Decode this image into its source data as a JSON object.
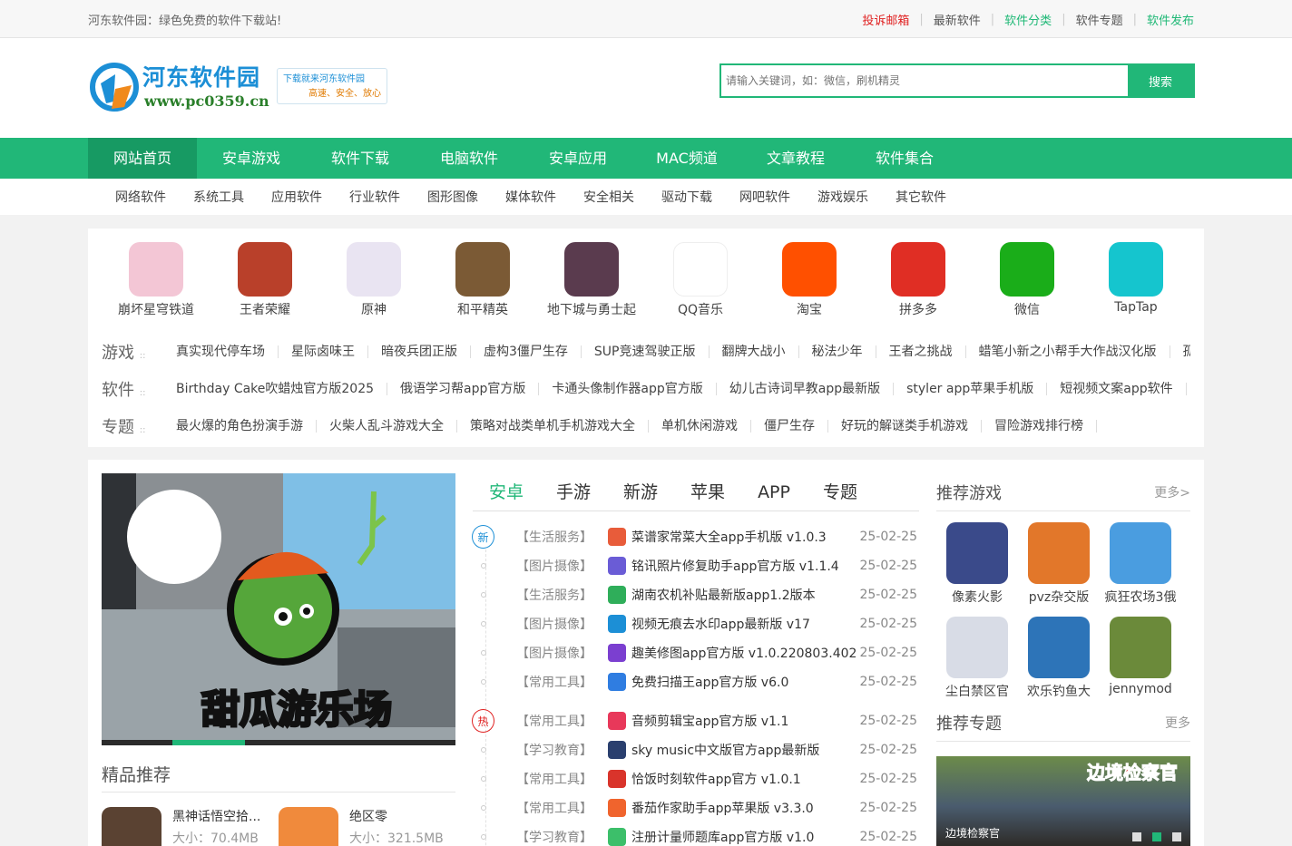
{
  "topbar": {
    "slogan": "河东软件园：绿色免费的软件下载站!",
    "links": [
      "投诉邮箱",
      "最新软件",
      "软件分类",
      "软件专题",
      "软件发布"
    ]
  },
  "header": {
    "logo_title": "河东软件园",
    "logo_url": "www.pc0359.cn",
    "slogan_line1": "下载就来河东软件园",
    "slogan_line2": "高速、安全、放心",
    "search_placeholder": "请输入关键词，如：微信，刷机精灵",
    "search_button": "搜索"
  },
  "nav": [
    "网站首页",
    "安卓游戏",
    "软件下载",
    "电脑软件",
    "安卓应用",
    "MAC频道",
    "文章教程",
    "软件集合"
  ],
  "subnav": [
    "网络软件",
    "系统工具",
    "应用软件",
    "行业软件",
    "图形图像",
    "媒体软件",
    "安全相关",
    "驱动下载",
    "网吧软件",
    "游戏娱乐",
    "其它软件"
  ],
  "hot_apps": [
    {
      "name": "崩坏星穹铁道",
      "color": "#f3c6d5"
    },
    {
      "name": "王者荣耀",
      "color": "#b9402a"
    },
    {
      "name": "原神",
      "color": "#e9e4f2"
    },
    {
      "name": "和平精英",
      "color": "#7b5a35"
    },
    {
      "name": "地下城与勇士起",
      "color": "#5a3b4e"
    },
    {
      "name": "QQ音乐",
      "color": "#ffffff"
    },
    {
      "name": "淘宝",
      "color": "#ff5000"
    },
    {
      "name": "拼多多",
      "color": "#e02e24"
    },
    {
      "name": "微信",
      "color": "#1aad19"
    },
    {
      "name": "TapTap",
      "color": "#15c5ce"
    }
  ],
  "tag_rows": [
    {
      "label": "游戏",
      "items": [
        "真实现代停车场",
        "星际卤味王",
        "暗夜兵团正版",
        "虚构3僵尸生存",
        "SUP竞速驾驶正版",
        "翻牌大战小",
        "秘法少年",
        "王者之挑战",
        "蜡笔小新之小帮手大作战汉化版",
        "孤"
      ]
    },
    {
      "label": "软件",
      "items": [
        "Birthday Cake吹蜡烛官方版2025",
        "俄语学习帮app官方版",
        "卡通头像制作器app官方版",
        "幼儿古诗词早教app最新版",
        "styler app苹果手机版",
        "短视频文案app软件"
      ]
    },
    {
      "label": "专题",
      "items": [
        "最火爆的角色扮演手游",
        "火柴人乱斗游戏大全",
        "策略对战类单机手机游戏大全",
        "单机休闲游戏",
        "僵尸生存",
        "好玩的解谜类手机游戏",
        "冒险游戏排行榜"
      ]
    }
  ],
  "banner": {
    "caption": "甜瓜游乐场"
  },
  "best": {
    "title": "精品推荐",
    "items": [
      {
        "name": "黑神话悟空拾...",
        "size": "大小：70.4MB"
      },
      {
        "name": "绝区零",
        "size": "大小：321.5MB"
      }
    ]
  },
  "tabs": [
    "安卓",
    "手游",
    "新游",
    "苹果",
    "APP",
    "专题"
  ],
  "badges": {
    "new": "新",
    "hot": "热"
  },
  "list_new": [
    {
      "cat": "【生活服务】",
      "title": "菜谱家常菜大全app手机版 v1.0.3",
      "date": "25-02-25",
      "color": "#e85c3a"
    },
    {
      "cat": "【图片摄像】",
      "title": "铭讯照片修复助手app官方版 v1.1.4",
      "date": "25-02-25",
      "color": "#6a5cd6"
    },
    {
      "cat": "【生活服务】",
      "title": "湖南农机补贴最新版app1.2版本",
      "date": "25-02-25",
      "color": "#2fae5a"
    },
    {
      "cat": "【图片摄像】",
      "title": "视频无痕去水印app最新版 v17",
      "date": "25-02-25",
      "color": "#1c8fd6"
    },
    {
      "cat": "【图片摄像】",
      "title": "趣美修图app官方版 v1.0.220803.402",
      "date": "25-02-25",
      "color": "#7b3fd0"
    },
    {
      "cat": "【常用工具】",
      "title": "免费扫描王app官方版 v6.0",
      "date": "25-02-25",
      "color": "#2f7de1"
    }
  ],
  "list_hot": [
    {
      "cat": "【常用工具】",
      "title": "音频剪辑宝app官方版 v1.1",
      "date": "25-02-25",
      "color": "#e8385a"
    },
    {
      "cat": "【学习教育】",
      "title": "sky music中文版官方app最新版",
      "date": "25-02-25",
      "color": "#2a3f6e"
    },
    {
      "cat": "【常用工具】",
      "title": "恰饭时刻软件app官方 v1.0.1",
      "date": "25-02-25",
      "color": "#d9342b"
    },
    {
      "cat": "【常用工具】",
      "title": "番茄作家助手app苹果版 v3.3.0",
      "date": "25-02-25",
      "color": "#f0642d"
    },
    {
      "cat": "【学习教育】",
      "title": "注册计量师题库app官方版 v1.0",
      "date": "25-02-25",
      "color": "#3cbf6a"
    }
  ],
  "side": {
    "games_title": "推荐游戏",
    "games_more": "更多>",
    "games": [
      {
        "name": "像素火影",
        "color": "#3a4a8a"
      },
      {
        "name": "pvz杂交版",
        "color": "#e2772a"
      },
      {
        "name": "疯狂农场3俄",
        "color": "#4a9de0"
      },
      {
        "name": "尘白禁区官",
        "color": "#d8dce6"
      },
      {
        "name": "欢乐钓鱼大",
        "color": "#2d74b8"
      },
      {
        "name": "jennymod",
        "color": "#6b8a3a"
      }
    ],
    "topics_title": "推荐专题",
    "topics_more": "更多",
    "topic_banner_text": "边境检察官",
    "topic_caption": "边境检察官"
  }
}
